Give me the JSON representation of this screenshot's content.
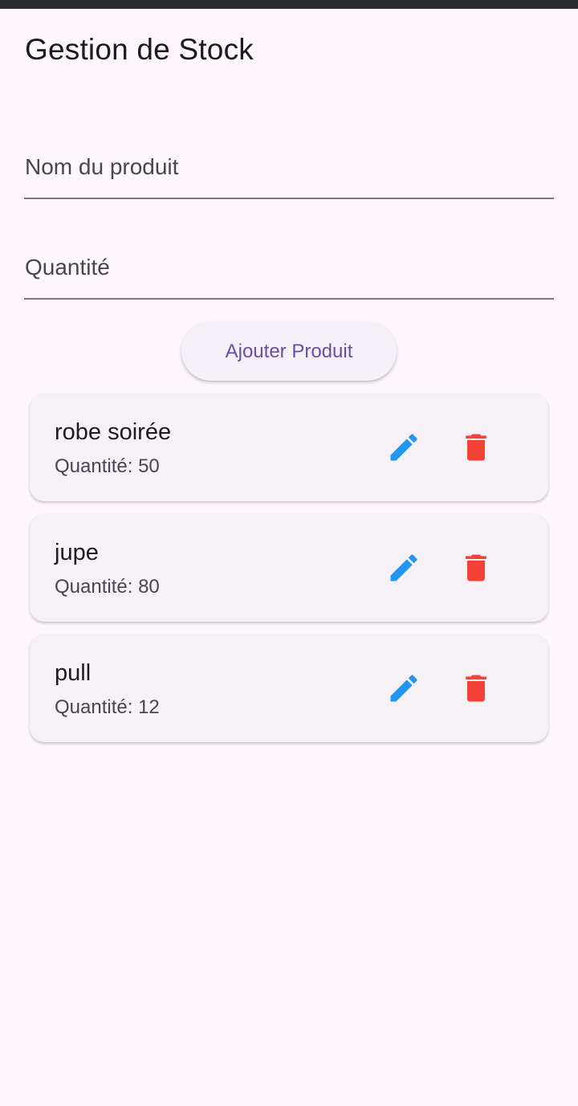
{
  "app": {
    "title": "Gestion de Stock"
  },
  "form": {
    "name_placeholder": "Nom du produit",
    "quantity_placeholder": "Quantité",
    "add_label": "Ajouter Produit"
  },
  "products": [
    {
      "name": "robe soirée",
      "quantity_text": "Quantité: 50"
    },
    {
      "name": "jupe",
      "quantity_text": "Quantité: 80"
    },
    {
      "name": "pull",
      "quantity_text": "Quantité: 12"
    }
  ],
  "icons": {
    "edit": "pencil-icon",
    "delete": "trash-icon"
  },
  "colors": {
    "background": "#fdf7fd",
    "card": "#f6f1f7",
    "accent": "#6750a4",
    "edit": "#2196f3",
    "delete": "#f44336"
  }
}
